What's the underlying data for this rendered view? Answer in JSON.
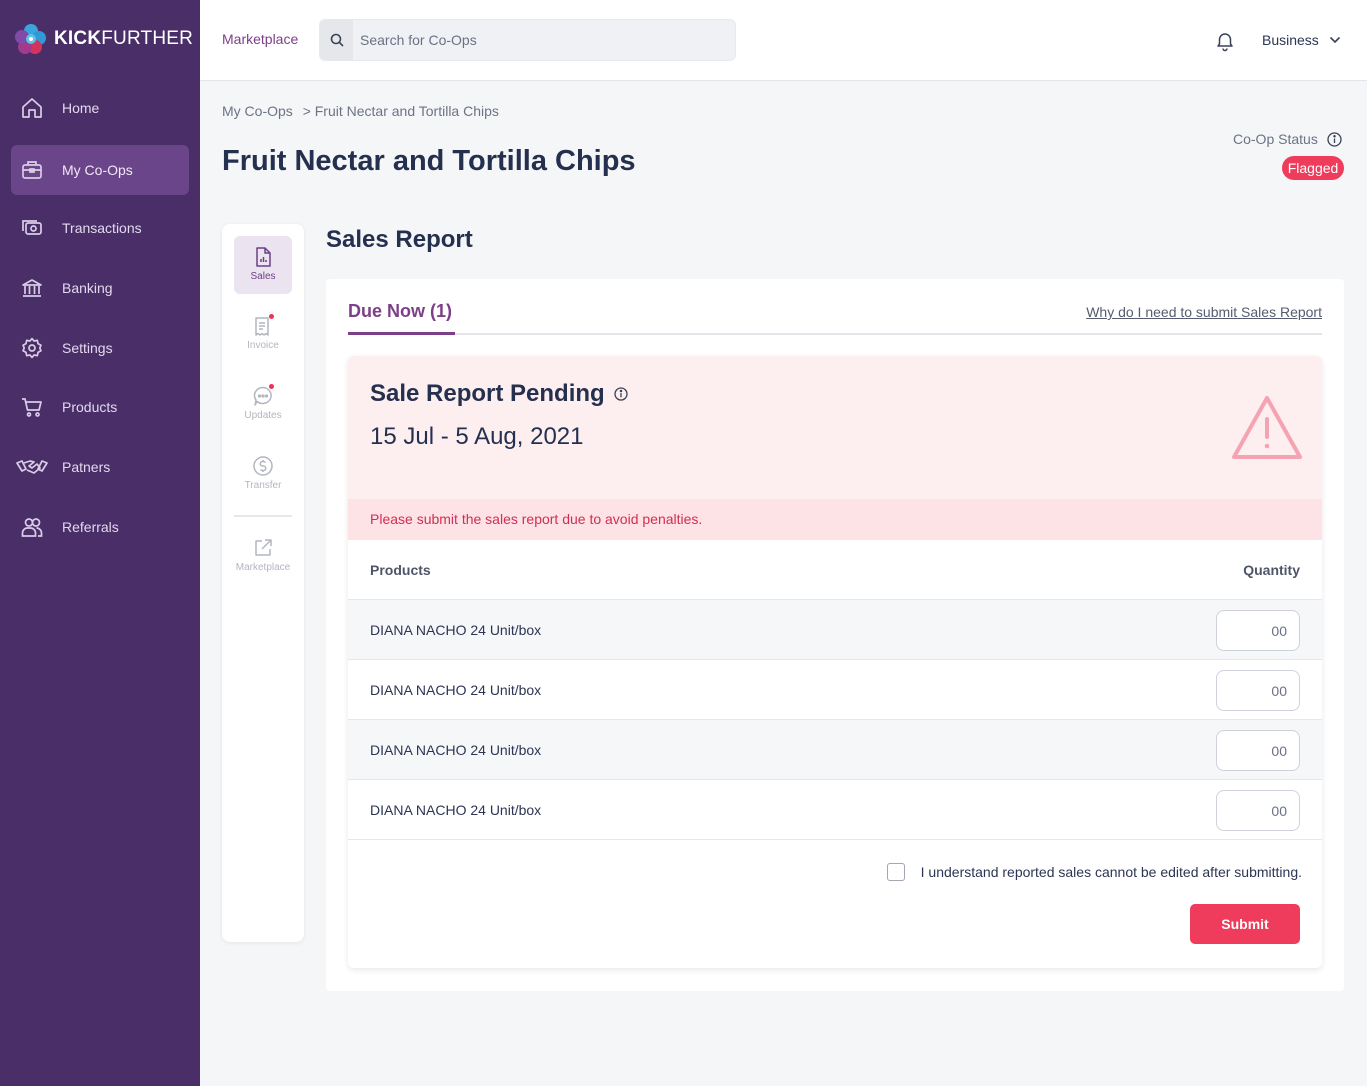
{
  "brand": {
    "name_bold": "KICK",
    "name_regular": "FURTHER"
  },
  "sidebar": {
    "items": [
      {
        "label": "Home",
        "icon": "home-icon"
      },
      {
        "label": "My Co-Ops",
        "icon": "briefcase-icon",
        "active": true
      },
      {
        "label": "Transactions",
        "icon": "cash-icon"
      },
      {
        "label": "Banking",
        "icon": "bank-icon"
      },
      {
        "label": "Settings",
        "icon": "gear-icon"
      },
      {
        "label": "Products",
        "icon": "cart-icon"
      },
      {
        "label": "Patners",
        "icon": "handshake-icon"
      },
      {
        "label": "Referrals",
        "icon": "users-icon"
      }
    ]
  },
  "topbar": {
    "marketplace": "Marketplace",
    "search_placeholder": "Search for Co-Ops",
    "account": "Business"
  },
  "breadcrumb": {
    "parent": "My Co-Ops",
    "current": "> Fruit Nectar and Tortilla Chips"
  },
  "page": {
    "title": "Fruit Nectar and Tortilla Chips",
    "status_label": "Co-Op Status",
    "status_value": "Flagged"
  },
  "subnav": {
    "items": [
      {
        "label": "Sales",
        "icon": "document-chart-icon",
        "active": true
      },
      {
        "label": "Invoice",
        "icon": "receipt-icon",
        "badge": true
      },
      {
        "label": "Updates",
        "icon": "chat-icon",
        "badge": true
      },
      {
        "label": "Transfer",
        "icon": "dollar-circle-icon"
      },
      {
        "label": "Marketplace",
        "icon": "external-link-icon"
      }
    ]
  },
  "main": {
    "section_title": "Sales Report",
    "tab": "Due Now (1)",
    "why_link": "Why do I need to submit Sales Report",
    "report": {
      "title": "Sale Report Pending",
      "date_range": "15 Jul - 5 Aug, 2021",
      "notice": "Please submit the sales report due to avoid penalties.",
      "columns": {
        "product": "Products",
        "quantity": "Quantity"
      },
      "rows": [
        {
          "product": "DIANA NACHO 24 Unit/box",
          "qty_placeholder": "00"
        },
        {
          "product": "DIANA NACHO 24 Unit/box",
          "qty_placeholder": "00"
        },
        {
          "product": "DIANA NACHO 24 Unit/box",
          "qty_placeholder": "00"
        },
        {
          "product": "DIANA NACHO 24 Unit/box",
          "qty_placeholder": "00"
        }
      ],
      "agree_text": "I understand reported sales cannot be edited after submitting.",
      "submit_label": "Submit"
    }
  },
  "colors": {
    "sidebar": "#4a2e68",
    "accent": "#7d3f8a",
    "danger": "#ef3b5c"
  }
}
